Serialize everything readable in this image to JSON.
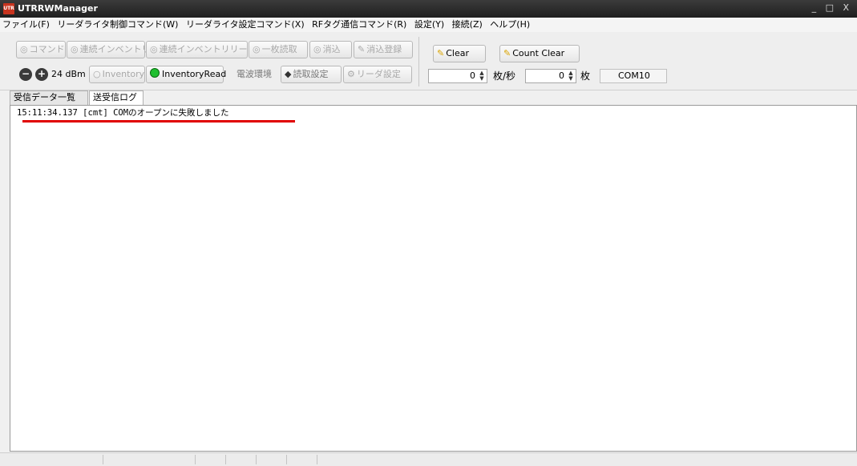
{
  "window": {
    "app_icon": "UTR",
    "title": "UTRRWManager",
    "controls": "_ □ X"
  },
  "menu": [
    "ファイル(F)",
    "リーダライタ制御コマンド(W)",
    "リーダライタ設定コマンド(X)",
    "RFタグ通信コマンド(R)",
    "設定(Y)",
    "接続(Z)",
    "ヘルプ(H)"
  ],
  "toolbar": {
    "row1": [
      {
        "icon": "gear-icon",
        "glyph": "◎",
        "label": "コマンド"
      },
      {
        "icon": "gear-icon",
        "glyph": "◎",
        "label": "連続インベントリ"
      },
      {
        "icon": "gear-icon",
        "glyph": "◎",
        "label": "連続インベントリリード"
      },
      {
        "icon": "gear-icon",
        "glyph": "◎",
        "label": "一枚読取"
      },
      {
        "icon": "gear-icon",
        "glyph": "◎",
        "label": "消込"
      },
      {
        "icon": "edit-icon",
        "glyph": "✎",
        "label": "消込登録"
      }
    ],
    "power_value": "24 dBm",
    "inventory_label": "Inventory",
    "inventory_read_label": "InventoryRead",
    "radio_env_label": "電波環境",
    "read_setting_label": "読取設定",
    "reader_setting_label": "リーダ設定",
    "clear_label": "Clear",
    "count_clear_label": "Count Clear",
    "rate_value": "0",
    "rate_unit": "枚/秒",
    "count_value": "0",
    "count_unit": "枚",
    "port": "COM10",
    "accent": "#1fbf2f"
  },
  "tabs": [
    "受信データ一覧",
    "送受信ログ"
  ],
  "log": [
    "15:11:34.137 [cmt] COMのオープンに失敗しました"
  ]
}
